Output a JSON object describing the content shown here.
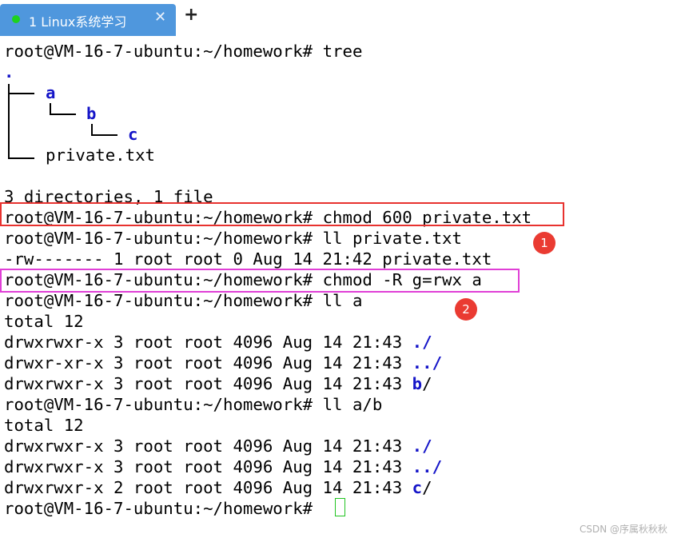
{
  "tab": {
    "label": "1 Linux系统学习",
    "close": "✕",
    "new": "+",
    "status_color": "#1ed21e"
  },
  "terminal": {
    "prompt": "root@VM-16-7-ubuntu:~/homework#",
    "cmd_tree": "tree",
    "tree": {
      "root": ".",
      "a": "a",
      "b": "b",
      "c": "c",
      "file": "private.txt"
    },
    "summary": "3 directories, 1 file",
    "cmd_chmod_file": "chmod 600 private.txt",
    "cmd_ll_file": "ll private.txt",
    "ll_file_out": "-rw------- 1 root root 0 Aug 14 21:42 private.txt",
    "cmd_chmod_dir": "chmod -R g=rwx a",
    "cmd_ll_a": "ll a",
    "total_a": "total 12",
    "ll_a": [
      {
        "meta": "drwxrwxr-x 3 root root 4096 Aug 14 21:43 ",
        "name": "./"
      },
      {
        "meta": "drwxr-xr-x 3 root root 4096 Aug 14 21:43 ",
        "name": "../"
      },
      {
        "meta": "drwxrwxr-x 3 root root 4096 Aug 14 21:43 ",
        "name": "b",
        "suffix": "/"
      }
    ],
    "cmd_ll_ab": "ll a/b",
    "total_ab": "total 12",
    "ll_ab": [
      {
        "meta": "drwxrwxr-x 3 root root 4096 Aug 14 21:43 ",
        "name": "./"
      },
      {
        "meta": "drwxrwxr-x 3 root root 4096 Aug 14 21:43 ",
        "name": "../"
      },
      {
        "meta": "drwxrwxr-x 2 root root 4096 Aug 14 21:43 ",
        "name": "c",
        "suffix": "/"
      }
    ]
  },
  "annotations": {
    "badge1": "1",
    "badge2": "2",
    "red_color": "#e8322f",
    "purple_color": "#e03fd6"
  },
  "watermark": "CSDN @序属秋秋秋"
}
